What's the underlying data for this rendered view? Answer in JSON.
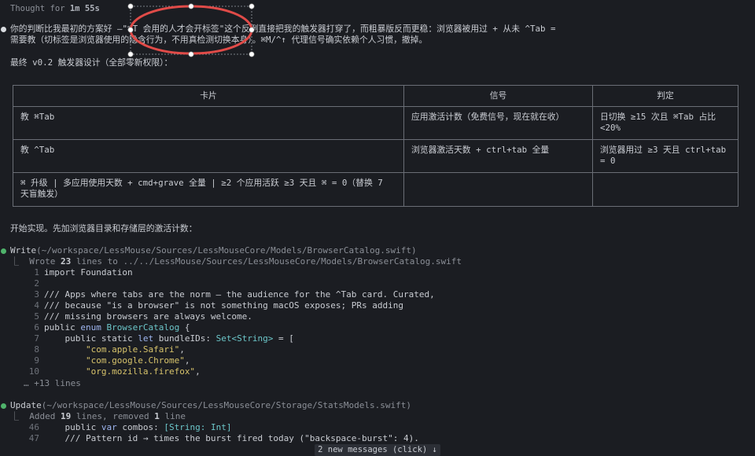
{
  "thought": {
    "prefix": "Thought for ",
    "duration": "1m 55s"
  },
  "intro": {
    "line1": "你的判断比我最初的方案好 —\"⌘T 会用的人才会开标签\"这个反例直接把我的触发器打穿了，而粗暴版反而更稳：浏览器被用过 + 从未 ^Tab =",
    "line2": "需要教（切标签是浏览器使用的隐含行为，不用真检测切换本身）。⌘M/^↑ 代理信号确实依赖个人习惯，撤掉。"
  },
  "design_heading": "最终 v0.2 触发器设计（全部零新权限）：",
  "table": {
    "headers": [
      "卡片",
      "信号",
      "判定"
    ],
    "rows": [
      {
        "card": "教 ⌘Tab",
        "signal": "应用激活计数（免费信号，现在就在收）",
        "rule": "日切换 ≥15 次且 ⌘Tab 占比 <20%"
      },
      {
        "card": "教 ^Tab",
        "signal": "浏览器激活天数 + ctrl+tab 全量",
        "rule": "浏览器用过 ≥3 天且 ctrl+tab = 0"
      },
      {
        "card": "⌘ 升级 | 多应用使用天数 + cmd+grave 全量 | ≥2 个应用活跃 ≥3 天且 ⌘ = 0（替换 7 天盲触发）",
        "signal": "",
        "rule": ""
      }
    ]
  },
  "start_text": "开始实现。先加浏览器目录和存储层的激活计数：",
  "write_tool": {
    "name": "Write",
    "arg": "(~/workspace/LessMouse/Sources/LessMouseCore/Models/BrowserCatalog.swift)",
    "summary_prefix": "Wrote ",
    "summary_count": "23",
    "summary_suffix": " lines to ../../LessMouse/Sources/LessMouseCore/Models/BrowserCatalog.swift",
    "lines": [
      {
        "n": "1",
        "text": "import Foundation"
      },
      {
        "n": "2",
        "text": ""
      },
      {
        "n": "3",
        "text": "/// Apps where tabs are the norm — the audience for the ^Tab card. Curated,"
      },
      {
        "n": "4",
        "text": "/// because \"is a browser\" is not something macOS exposes; PRs adding"
      },
      {
        "n": "5",
        "text": "/// missing browsers are always welcome."
      }
    ],
    "line6": {
      "n": "6",
      "a": "public ",
      "b": "enum ",
      "c": "BrowserCatalog",
      "d": " {"
    },
    "line7": {
      "n": "7",
      "a": "    public static ",
      "b": "let ",
      "c": "bundleIDs: ",
      "d": "Set<String>",
      "e": " = ["
    },
    "strings": [
      {
        "n": "8",
        "s": "\"com.apple.Safari\"",
        "t": ","
      },
      {
        "n": "9",
        "s": "\"com.google.Chrome\"",
        "t": ","
      },
      {
        "n": "10",
        "s": "\"org.mozilla.firefox\"",
        "t": ","
      }
    ],
    "more": "… +13 lines"
  },
  "update_tool": {
    "name": "Update",
    "arg": "(~/workspace/LessMouse/Sources/LessMouseCore/Storage/StatsModels.swift)",
    "summary_a": "Added ",
    "added": "19",
    "summary_b": " lines, removed ",
    "removed": "1",
    "summary_c": " line",
    "line46": {
      "n": "46",
      "a": "    public ",
      "b": "var ",
      "c": "combos: ",
      "d": "[String: Int]"
    },
    "line47": {
      "n": "47",
      "text": "    /// Pattern id → times the burst fired today (\"backspace-burst\": 4)."
    }
  },
  "new_messages": "2 new messages (click) ↓",
  "colors": {
    "bg": "#1b1d22",
    "annotation": "#e04b48",
    "accent_green": "#4fb36b"
  }
}
